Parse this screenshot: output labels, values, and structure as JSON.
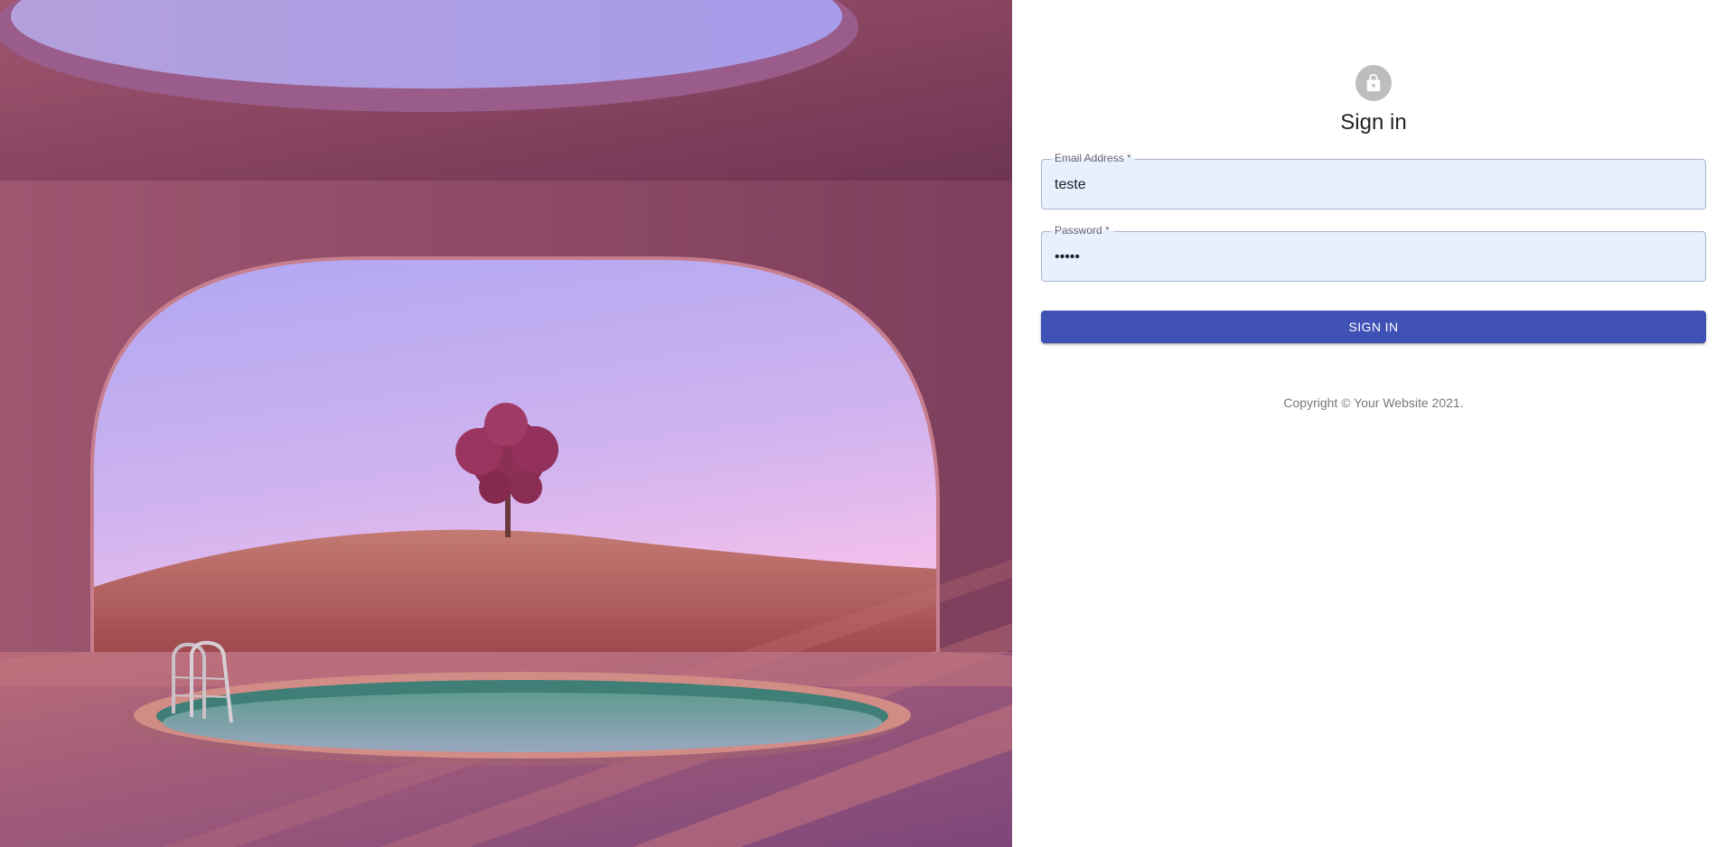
{
  "hero": {
    "icon": "hero-landscape-image"
  },
  "signin": {
    "icon": "lock-icon",
    "title": "Sign in",
    "email": {
      "label": "Email Address *",
      "value": "teste"
    },
    "password": {
      "label": "Password *",
      "value": "•••••"
    },
    "button_label": "SIGN IN",
    "copyright": {
      "prefix": "Copyright © ",
      "link": "Your Website",
      "suffix": " 2021."
    }
  },
  "colors": {
    "primary": "#3f51b5",
    "autofill_bg": "#e8f0fe",
    "avatar_bg": "#bdbdbd"
  }
}
